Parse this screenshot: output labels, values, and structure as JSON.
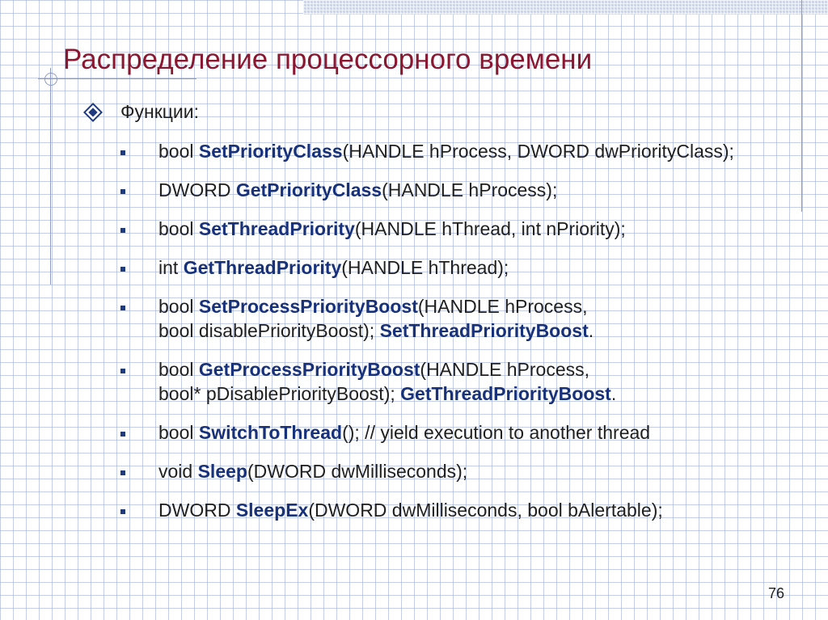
{
  "title": "Распределение процессорного времени",
  "section_label": "Функции:",
  "colors": {
    "title": "#8a1730",
    "function_name": "#17317a",
    "text": "#1f1f1f"
  },
  "items": [
    {
      "l1_pre": "bool ",
      "l1_fn": "SetPriorityClass",
      "l1_post": "(HANDLE hProcess, DWORD dwPriorityClass);"
    },
    {
      "l1_pre": "DWORD ",
      "l1_fn": "GetPriorityClass",
      "l1_post": "(HANDLE hProcess);"
    },
    {
      "l1_pre": "bool ",
      "l1_fn": "SetThreadPriority",
      "l1_post": "(HANDLE hThread, int nPriority);"
    },
    {
      "l1_pre": "int ",
      "l1_fn": "GetThreadPriority",
      "l1_post": "(HANDLE hThread);"
    },
    {
      "l1_pre": "bool ",
      "l1_fn": "SetProcessPriorityBoost",
      "l1_post": "(HANDLE hProcess,",
      "l2_pre": "bool disablePriorityBoost); ",
      "l2_fn": "SetThreadPriorityBoost",
      "l2_post": "."
    },
    {
      "l1_pre": "bool ",
      "l1_fn": "GetProcessPriorityBoost",
      "l1_post": "(HANDLE hProcess,",
      "l2_pre": "bool* pDisablePriorityBoost); ",
      "l2_fn": "GetThreadPriorityBoost",
      "l2_post": "."
    },
    {
      "l1_pre": "bool ",
      "l1_fn": "SwitchToThread",
      "l1_post": "(); // yield execution to another thread"
    },
    {
      "l1_pre": "void ",
      "l1_fn": "Sleep",
      "l1_post": "(DWORD dwMilliseconds);"
    },
    {
      "l1_pre": "DWORD ",
      "l1_fn": "SleepEx",
      "l1_post": "(DWORD dwMilliseconds, bool bAlertable);"
    }
  ],
  "page_number": "76"
}
